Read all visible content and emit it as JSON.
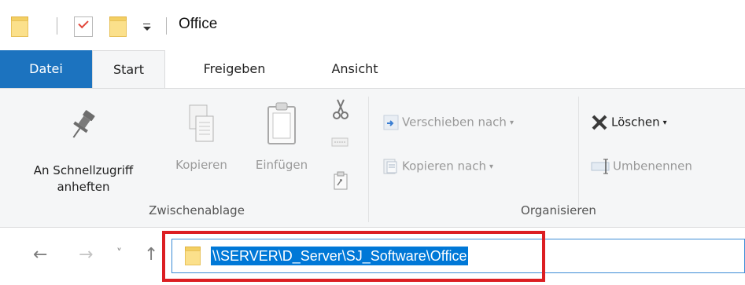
{
  "window": {
    "title": "Office"
  },
  "tabs": [
    {
      "label": "Datei"
    },
    {
      "label": "Start"
    },
    {
      "label": "Freigeben"
    },
    {
      "label": "Ansicht"
    }
  ],
  "ribbon": {
    "clipboard": {
      "pin_label_line1": "An Schnellzugriff",
      "pin_label_line2": "anheften",
      "copy_label": "Kopieren",
      "paste_label": "Einfügen",
      "group_label": "Zwischenablage"
    },
    "organize": {
      "move_to": "Verschieben nach",
      "copy_to": "Kopieren nach",
      "delete": "Löschen",
      "rename": "Umbenennen",
      "group_label": "Organisieren"
    }
  },
  "address_bar": {
    "path": "\\\\SERVER\\D_Server\\SJ_Software\\Office"
  },
  "colors": {
    "file_tab": "#1c73bf",
    "selection": "#0078d7",
    "callout": "#dc1e22"
  }
}
